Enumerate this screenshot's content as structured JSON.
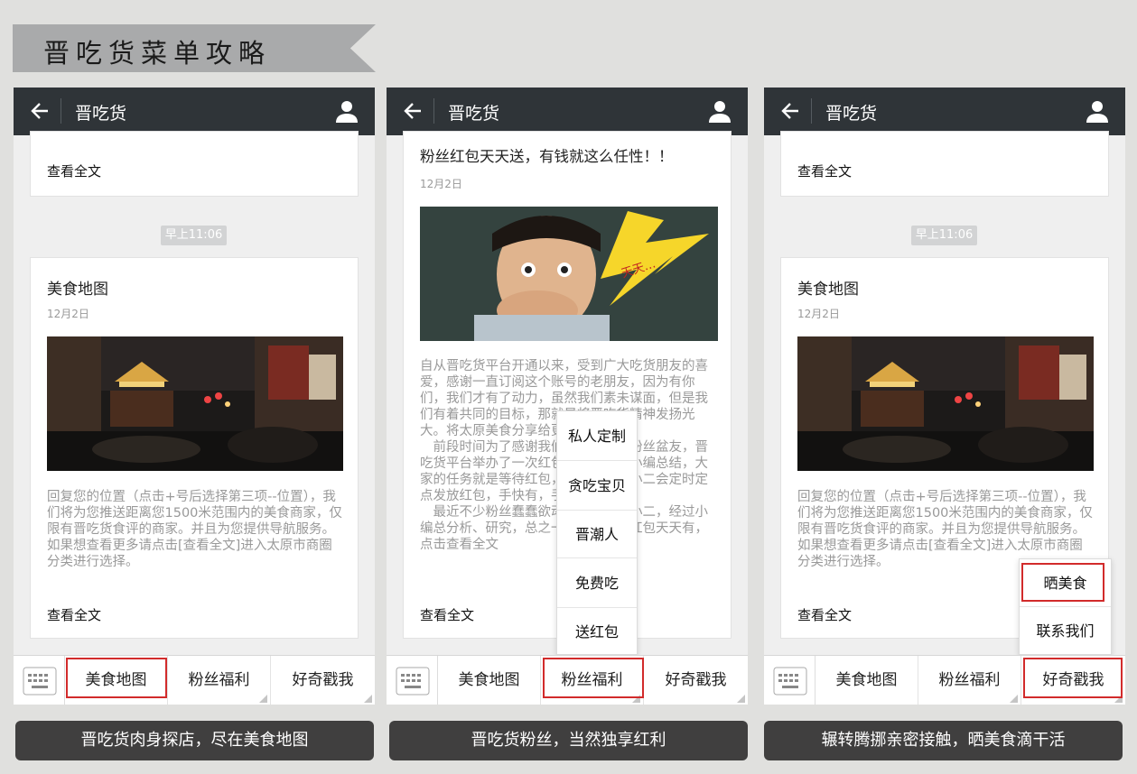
{
  "banner": {
    "title": "晋吃货菜单攻略"
  },
  "colors": {
    "titlebar": "#2f3438",
    "highlight": "#d22b2b",
    "caption_bg": "#403f3f"
  },
  "phones": [
    {
      "title": "晋吃货",
      "top_card": {
        "link": "查看全文"
      },
      "time_badge": "早上11:06",
      "card": {
        "title": "美食地图",
        "date": "12月2日",
        "body": "回复您的位置（点击+号后选择第三项--位置），我们将为您推送距离您1500米范围内的美食商家，仅限有晋吃货食评的商家。并且为您提供导航服务。如果想查看更多请点击[查看全文]进入太原市商圈分类进行选择。",
        "link": "查看全文"
      },
      "menu": [
        "美食地图",
        "粉丝福利",
        "好奇戳我"
      ],
      "caption": "晋吃货肉身探店，尽在美食地图"
    },
    {
      "title": "晋吃货",
      "card": {
        "title": "粉丝红包天天送，有钱就这么任性！！",
        "date": "12月2日",
        "image_text": "天天…",
        "body": "自从晋吃货平台开通以来，受到广大吃货朋友的喜爱，感谢一直订阅这个账号的老朋友，因为有你们，我们才有了动力，虽然我们素未谋面，但是我们有着共同的目标，那就是将晋吃货精神发扬光大。将太原美食分享给更多的人。\n　前段时间为了感谢我们一直以来的粉丝盆友，晋吃货平台举办了一次红包雨活动。据小编总结，大家的任务就是等待红包，我们晋吃货小二会定时定点发放红包，手快有，手慢就是嗨皮！\n　最近不少粉丝蠢蠢欲动，问我们家小二，经过小编总分析、研究，总之一句话，希望红包天天有，点击查看全文",
        "link": "查看全文"
      },
      "popup": [
        "私人定制",
        "贪吃宝贝",
        "晋潮人",
        "免费吃",
        "送红包"
      ],
      "menu": [
        "美食地图",
        "粉丝福利",
        "好奇戳我"
      ],
      "caption": "晋吃货粉丝，当然独享红利"
    },
    {
      "title": "晋吃货",
      "top_card": {
        "link": "查看全文"
      },
      "time_badge": "早上11:06",
      "card": {
        "title": "美食地图",
        "date": "12月2日",
        "body": "回复您的位置（点击+号后选择第三项--位置），我们将为您推送距离您1500米范围内的美食商家，仅限有晋吃货食评的商家。并且为您提供导航服务。如果想查看更多请点击[查看全文]进入太原市商圈分类进行选择。",
        "link": "查看全文"
      },
      "popup": [
        "晒美食",
        "联系我们"
      ],
      "menu": [
        "美食地图",
        "粉丝福利",
        "好奇戳我"
      ],
      "caption": "辗转腾挪亲密接触，晒美食滴干活"
    }
  ]
}
